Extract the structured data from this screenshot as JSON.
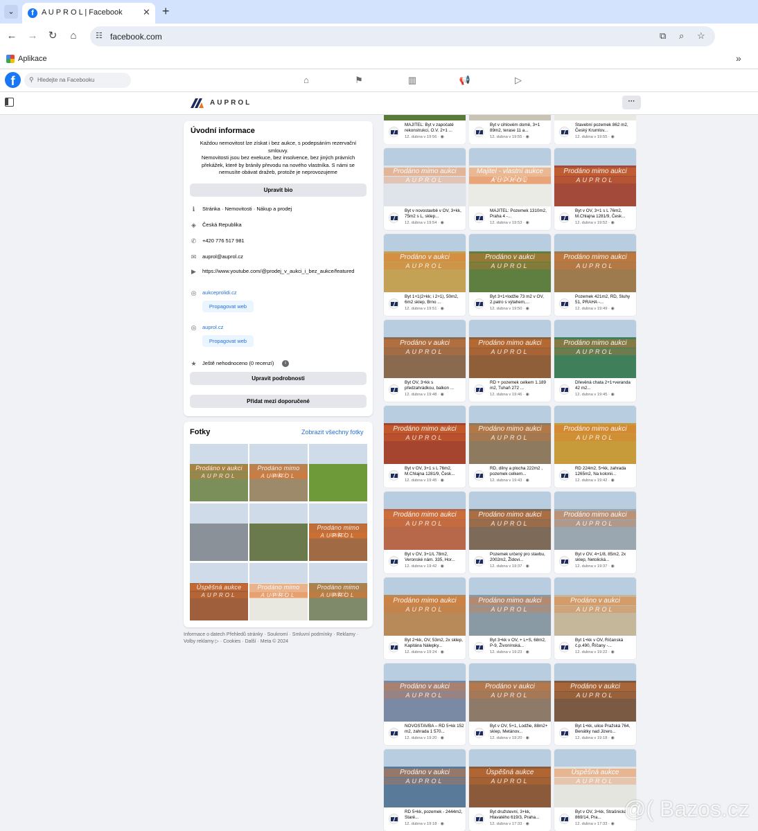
{
  "browser": {
    "tab_title": "A U P R O L | Facebook",
    "url": "facebook.com",
    "bookmarks_label": "Aplikace"
  },
  "facebook": {
    "search_placeholder": "Hledejte na Facebooku",
    "page_name": "AUPROL"
  },
  "intro": {
    "title": "Úvodní informace",
    "description": "Každou nemovitost lze získat i bez aukce, s podepsáním rezervační smlouvy.\nNemovitosti jsou bez exekuce, bez insolvence, bez jiných právních překážek, které by bránily převodu na nového vlastníka. S námi se nemusíte obávat dražeb, protože je neprovozujeme",
    "edit_bio_label": "Upravit bio",
    "category": "Stránka · Nemovitosti · Nákup a prodej",
    "country": "Česká Republika",
    "phone": "+420 776 517 981",
    "email": "auprol@auprol.cz",
    "youtube": "https://www.youtube.com/@prodej_v_aukci_i_bez_aukce/featured",
    "website1": "aukceprolidi.cz",
    "website2": "auprol.cz",
    "promote_label": "Propagovat web",
    "rating": "Ještě nehodnoceno (0 recenzí)",
    "edit_details_label": "Upravit podrobnosti",
    "recommend_label": "Přidat mezi doporučené"
  },
  "photos": {
    "title": "Fotky",
    "see_all": "Zobrazit všechny fotky",
    "items": [
      {
        "wm": "Prodáno v aukci",
        "bg": "#7a8f5a"
      },
      {
        "wm": "Prodáno mimo aukci",
        "bg": "#9c8a6a"
      },
      {
        "wm": "",
        "bg": "#6f9a3a"
      },
      {
        "wm": "",
        "bg": "#8a9199"
      },
      {
        "wm": "",
        "bg": "#6b7a4d"
      },
      {
        "wm": "Prodáno mimo aukci",
        "bg": "#a06a45"
      },
      {
        "wm": "Úspěšná aukce",
        "bg": "#a05f3c"
      },
      {
        "wm": "Prodáno mimo aukci",
        "bg": "#e8e8e0"
      },
      {
        "wm": "Prodáno mimo aukci",
        "bg": "#7f8a6a"
      }
    ],
    "wm_brand": "AUPROL"
  },
  "footer": "Informace o datech Přehledů stránky · Soukromí · Smluvní podmínky · Reklamy · Volby reklamy ▷ · Cookies · Další · Meta © 2024",
  "listings": [
    {
      "text": "MAJITEL: Byt v započaté rekonstrukci, O.V. 2+1 ...",
      "time": "12. dubna v 19:56",
      "wm": "",
      "bg": "#5a7a3a"
    },
    {
      "text": "Byt v cihlovém domě, 3+1 89m2, terase 11 a...",
      "time": "12. dubna v 19:55",
      "wm": "",
      "bg": "#c9c3b5"
    },
    {
      "text": "Stavební pozemek 862 m2, Český Krumlov...",
      "time": "12. dubna v 19:55",
      "wm": "",
      "bg": "#e9e9e4"
    },
    {
      "text": "Byt v novostavbě v OV, 3+kk, 75m2 s L, sklep...",
      "time": "12. dubna v 19:54",
      "wm": "Prodáno mimo aukci",
      "bg": "#dfe3ea"
    },
    {
      "text": "MAJITEL: Pozemek 1310m2, Praha 4 -...",
      "time": "12. dubna v 19:53",
      "wm": "Majitel - vlastní aukce PRODÁNO",
      "bg": "#ebebe6"
    },
    {
      "text": "Byt v OV, 3+1 s L 76m2, M.Chlajna 1281/9, Česk...",
      "time": "12. dubna v 19:52",
      "wm": "Prodáno mimo aukci",
      "bg": "#a34a3a"
    },
    {
      "text": "Byt 1+1(2+kk; i 2+1), 50m2, 6m2 sklep, Brno ...",
      "time": "12. dubna v 19:51",
      "wm": "Prodáno v aukci",
      "bg": "#c4a255"
    },
    {
      "text": "Byt 3+1+lodžie 73 m2 v OV, 2.patro s výtahem,...",
      "time": "12. dubna v 19:50",
      "wm": "Prodáno v aukci",
      "bg": "#5e7f3f"
    },
    {
      "text": "Pozemek 421m2, RD, Sluhy 51, PRAHA -...",
      "time": "12. dubna v 19:49",
      "wm": "Prodáno mimo aukci",
      "bg": "#9e7a4f"
    },
    {
      "text": "Byt OV, 3+kk s předzahrádkou, balkon ...",
      "time": "12. dubna v 19:48",
      "wm": "Prodáno v aukci",
      "bg": "#8a6a4f"
    },
    {
      "text": "RD + pozemek celkem 1.189 m2, Tuhaň 272 ...",
      "time": "12. dubna v 19:46",
      "wm": "Prodáno mimo aukci",
      "bg": "#8f5f3a"
    },
    {
      "text": "Dřevěná chata 2+1+veranda 42 m2...",
      "time": "12. dubna v 19:45",
      "wm": "Prodáno mimo aukci",
      "bg": "#3f7f5a"
    },
    {
      "text": "Byt v OV, 3+1 s L 76m2, M.Chlajna 1281/9, Česk...",
      "time": "12. dubna v 19:45",
      "wm": "Prodáno mimo aukci",
      "bg": "#a5452f"
    },
    {
      "text": "RD, dílny a plocha 222m2 , pozemek celkem...",
      "time": "12. dubna v 19:43",
      "wm": "Prodáno mimo aukci",
      "bg": "#8d7a5f"
    },
    {
      "text": "RD 224m2, 5+kk, zahrada 1265m2, Na kolonii...",
      "time": "12. dubna v 19:42",
      "wm": "Prodáno mimo aukci",
      "bg": "#c79a3a"
    },
    {
      "text": "Byt v OV, 3+1/L 78m2, Veronské nám. 335, Hor...",
      "time": "12. dubna v 19:42",
      "wm": "Prodáno mimo aukci",
      "bg": "#b8684a"
    },
    {
      "text": "Pozemek určený pro stavbu, 2002m2, Židovi...",
      "time": "12. dubna v 19:37",
      "wm": "Prodáno mimo aukci",
      "bg": "#7d6a58"
    },
    {
      "text": "Byt v OV, 4+1/8, 85m2, 2x sklep, Netolická...",
      "time": "12. dubna v 19:37",
      "wm": "Prodáno mimo aukci",
      "bg": "#9aa7b0"
    },
    {
      "text": "Byt 2+kk, OV, 53m2, 2x sklep, Kapitána Nálepky...",
      "time": "12. dubna v 19:24",
      "wm": "Prodáno mimo aukci",
      "bg": "#b88a5a"
    },
    {
      "text": "Byt 3+kk v OV, + L+S, 68m2, P-9, Živonínská...",
      "time": "12. dubna v 19:23",
      "wm": "Prodáno mimo aukci",
      "bg": "#8a9aa5"
    },
    {
      "text": "Byt 1+kk v OV, Říčanská č.p.490, Říčany -...",
      "time": "12. dubna v 19:22",
      "wm": "Prodáno v aukci",
      "bg": "#c5b89a"
    },
    {
      "text": "NOVOSTAVBA – RD 5+kk 152 m2, zahrada 1 570...",
      "time": "12. dubna v 19:20",
      "wm": "Prodáno v aukci",
      "bg": "#7a8aa5"
    },
    {
      "text": "Byt v OV, 5+1, Lodžie, 88m2+ sklep, Metánov...",
      "time": "12. dubna v 19:20",
      "wm": "Prodáno v aukci",
      "bg": "#8e7a68"
    },
    {
      "text": "Byt 1+kk, ulice Pražská 764, Benátky nad Jizero...",
      "time": "12. dubna v 19:18",
      "wm": "Prodáno v aukci",
      "bg": "#7a5a42"
    },
    {
      "text": "RD 5+kk, pozemek - 2444m2, Staré...",
      "time": "12. dubna v 19:18",
      "wm": "Prodáno v aukci",
      "bg": "#5a7a9a"
    },
    {
      "text": "Byt družstevní, 3+kk, Hlavatého 619/3, Praha...",
      "time": "12. dubna v 17:33",
      "wm": "Úspěšná aukce",
      "bg": "#8a5a3a"
    },
    {
      "text": "Byt v OV, 3+kk, Strašnická 869/14, Pra...",
      "time": "12. dubna v 17:33",
      "wm": "Úspěšná aukce",
      "bg": "#e5e5e0"
    }
  ],
  "listing_brand": "AUPROL",
  "watermark": "@( Bazos.cz"
}
